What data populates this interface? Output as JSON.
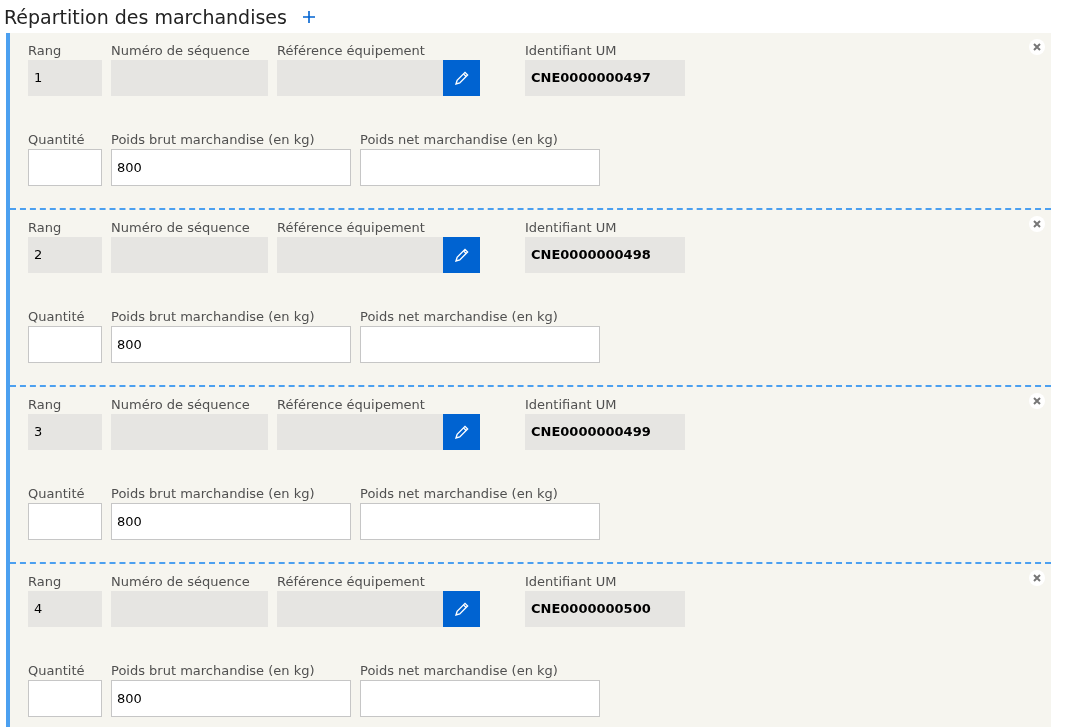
{
  "title": "Répartition des marchandises",
  "items": [
    {
      "rows": [
        [
          {
            "kind": "static",
            "label": "Rang",
            "value": "1"
          },
          {
            "kind": "static",
            "label": "Numéro de séquence"
          },
          {
            "kind": "lookup",
            "label": "Référence équipement"
          },
          {
            "kind": "code",
            "label": "Identifiant UM",
            "value": "CNE0000000497"
          }
        ],
        [
          {
            "kind": "input",
            "label": "Quantité"
          },
          {
            "kind": "input",
            "label": "Poids brut marchandise (en kg)",
            "value": "800"
          },
          {
            "kind": "input",
            "label": "Poids net marchandise (en kg)"
          }
        ]
      ]
    },
    {
      "rows": [
        [
          {
            "kind": "static",
            "label": "Rang",
            "value": "2"
          },
          {
            "kind": "static",
            "label": "Numéro de séquence"
          },
          {
            "kind": "lookup",
            "label": "Référence équipement"
          },
          {
            "kind": "code",
            "label": "Identifiant UM",
            "value": "CNE0000000498"
          }
        ],
        [
          {
            "kind": "input",
            "label": "Quantité"
          },
          {
            "kind": "input",
            "label": "Poids brut marchandise (en kg)",
            "value": "800"
          },
          {
            "kind": "input",
            "label": "Poids net marchandise (en kg)"
          }
        ]
      ]
    },
    {
      "rows": [
        [
          {
            "kind": "static",
            "label": "Rang",
            "value": "3"
          },
          {
            "kind": "static",
            "label": "Numéro de séquence"
          },
          {
            "kind": "lookup",
            "label": "Référence équipement"
          },
          {
            "kind": "code",
            "label": "Identifiant UM",
            "value": "CNE0000000499"
          }
        ],
        [
          {
            "kind": "input",
            "label": "Quantité"
          },
          {
            "kind": "input",
            "label": "Poids brut marchandise (en kg)",
            "value": "800"
          },
          {
            "kind": "input",
            "label": "Poids net marchandise (en kg)"
          }
        ]
      ]
    },
    {
      "rows": [
        [
          {
            "kind": "static",
            "label": "Rang",
            "value": "4"
          },
          {
            "kind": "static",
            "label": "Numéro de séquence"
          },
          {
            "kind": "lookup",
            "label": "Référence équipement"
          },
          {
            "kind": "code",
            "label": "Identifiant UM",
            "value": "CNE0000000500"
          }
        ],
        [
          {
            "kind": "input",
            "label": "Quantité"
          },
          {
            "kind": "input",
            "label": "Poids brut marchandise (en kg)",
            "value": "800"
          },
          {
            "kind": "input",
            "label": "Poids net marchandise (en kg)"
          }
        ]
      ]
    }
  ]
}
